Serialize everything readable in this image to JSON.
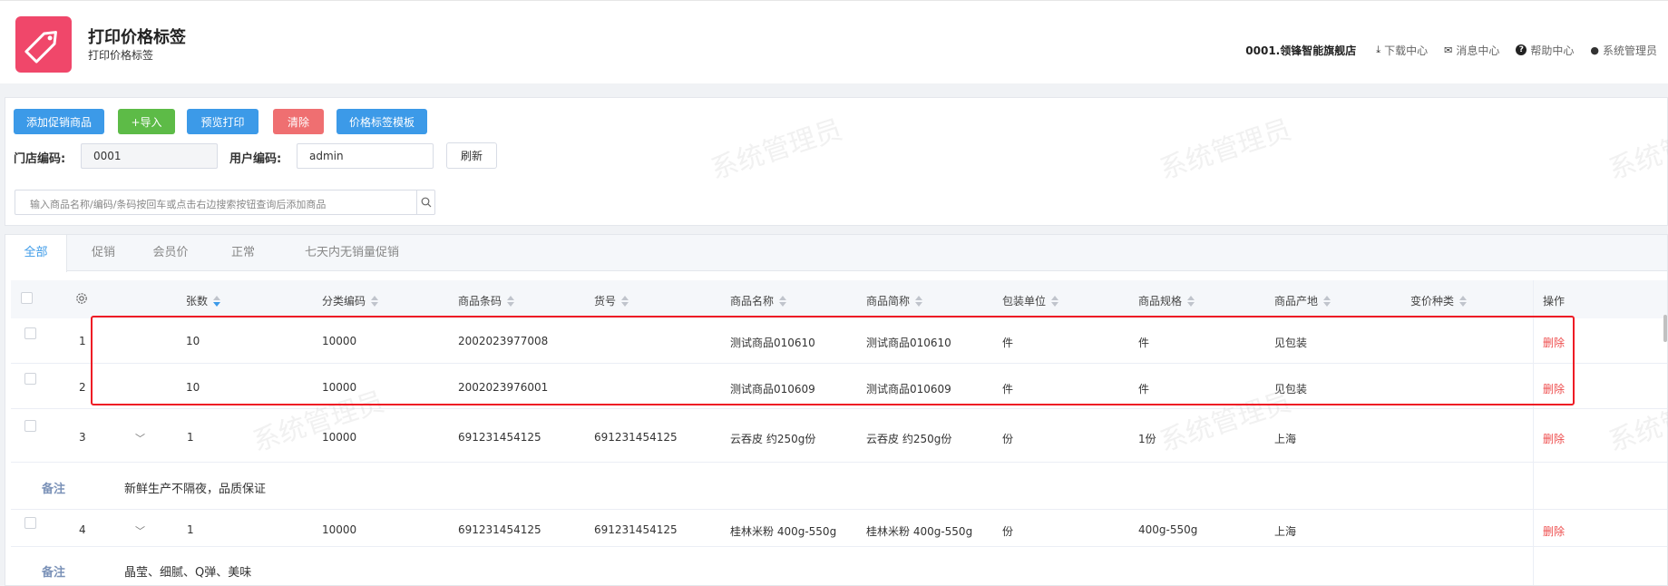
{
  "header": {
    "title": "打印价格标签",
    "subtitle": "打印价格标签",
    "shop": "0001.领锋智能旗舰店",
    "download": "下载中心",
    "messages": "消息中心",
    "help": "帮助中心",
    "user": "系统管理员"
  },
  "toolbar": {
    "add_promo": "添加促销商品",
    "import": "+导入",
    "preview": "预览打印",
    "clear": "清除",
    "template": "价格标签模板",
    "store_label": "门店编码:",
    "store_value": "0001",
    "user_label": "用户编码:",
    "user_value": "admin",
    "refresh": "刷新",
    "search_placeholder": "输入商品名称/编码/条码按回车或点击右边搜索按钮查询后添加商品"
  },
  "tabs": [
    "全部",
    "促销",
    "会员价",
    "正常",
    "七天内无销量促销"
  ],
  "active_tab": 0,
  "columns": {
    "count": "张数",
    "category": "分类编码",
    "barcode": "商品条码",
    "item_no": "货号",
    "name": "商品名称",
    "short_name": "商品简称",
    "unit": "包装单位",
    "spec": "商品规格",
    "origin": "商品产地",
    "price_type": "变价种类",
    "action": "操作"
  },
  "rows": [
    {
      "index": "1",
      "count": "10",
      "category": "10000",
      "barcode": "2002023977008",
      "item_no": "",
      "name": "测试商品010610",
      "short_name": "测试商品010610",
      "unit": "件",
      "spec": "件",
      "origin": "见包装",
      "price_type": "",
      "action": "删除"
    },
    {
      "index": "2",
      "count": "10",
      "category": "10000",
      "barcode": "2002023976001",
      "item_no": "",
      "name": "测试商品010609",
      "short_name": "测试商品010609",
      "unit": "件",
      "spec": "件",
      "origin": "见包装",
      "price_type": "",
      "action": "删除"
    },
    {
      "index": "3",
      "count": "1",
      "category": "10000",
      "barcode": "691231454125",
      "item_no": "691231454125",
      "name": "云吞皮 约250g份",
      "short_name": "云吞皮 约250g份",
      "unit": "份",
      "spec": "1份",
      "origin": "上海",
      "price_type": "",
      "action": "删除",
      "note_label": "备注",
      "note": "新鲜生产不隔夜，品质保证"
    },
    {
      "index": "4",
      "count": "1",
      "category": "10000",
      "barcode": "691231454125",
      "item_no": "691231454125",
      "name": "桂林米粉 400g-550g",
      "short_name": "桂林米粉 400g-550g",
      "unit": "份",
      "spec": "400g-550g",
      "origin": "上海",
      "price_type": "",
      "action": "删除",
      "note_label": "备注",
      "note": "晶莹、细腻、Q弹、美味"
    }
  ],
  "watermark": "系统管理员",
  "colors": {
    "primary": "#3c9ae8",
    "success": "#5dbb47",
    "danger": "#ef6f71",
    "highlight": "#ee1c25",
    "logo": "#f0476a"
  }
}
